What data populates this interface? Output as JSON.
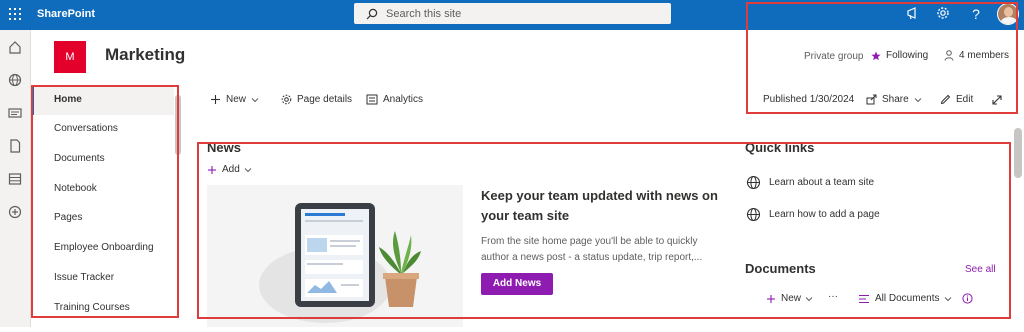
{
  "app": {
    "brand": "SharePoint"
  },
  "search": {
    "placeholder": "Search this site"
  },
  "site": {
    "logo_letter": "M",
    "title": "Marketing"
  },
  "nav": {
    "items": [
      {
        "label": "Home",
        "selected": true
      },
      {
        "label": "Conversations"
      },
      {
        "label": "Documents"
      },
      {
        "label": "Notebook"
      },
      {
        "label": "Pages"
      },
      {
        "label": "Employee Onboarding"
      },
      {
        "label": "Issue Tracker"
      },
      {
        "label": "Training Courses"
      }
    ]
  },
  "commands": {
    "new_label": "New",
    "page_details_label": "Page details",
    "analytics_label": "Analytics"
  },
  "header_meta": {
    "privacy": "Private group",
    "following": "Following",
    "members": "4 members",
    "published": "Published 1/30/2024",
    "share": "Share",
    "edit": "Edit"
  },
  "news": {
    "title": "News",
    "add_label": "Add",
    "headline": "Keep your team updated with news on your team site",
    "description": "From the site home page you'll be able to quickly author a news post - a status update, trip report,...",
    "add_news_button": "Add News"
  },
  "quick_links": {
    "title": "Quick links",
    "items": [
      "Learn about a team site",
      "Learn how to add a page"
    ]
  },
  "documents": {
    "title": "Documents",
    "see_all": "See all",
    "new_label": "New",
    "more_label": "···",
    "view_label": "All Documents"
  },
  "colors": {
    "suite_bar": "#0f6cbd",
    "accent": "#8f1cb0",
    "site_logo": "#e3002b",
    "highlight": "#e03c3c"
  }
}
